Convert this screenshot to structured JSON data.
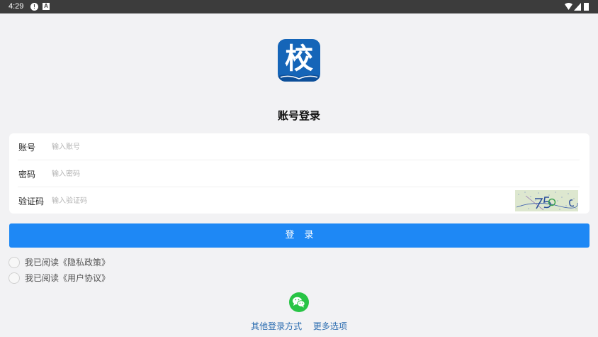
{
  "status_bar": {
    "time": "4:29",
    "alert_glyph": "!",
    "notification_glyph": "A",
    "icons": [
      "alert-icon",
      "a-notification-icon",
      "wifi-icon",
      "signal-icon",
      "battery-icon"
    ]
  },
  "logo": {
    "glyph": "校",
    "color": "#1565b8"
  },
  "title": "账号登录",
  "form": {
    "account": {
      "label": "账号",
      "placeholder": "输入账号",
      "value": ""
    },
    "password": {
      "label": "密码",
      "placeholder": "输入密码",
      "value": ""
    },
    "captcha": {
      "label": "验证码",
      "placeholder": "输入验证码",
      "value": ""
    }
  },
  "login_button": {
    "label": "登录",
    "color": "#1e88f5"
  },
  "agreements": [
    {
      "text": "我已阅读《隐私政策》",
      "checked": false
    },
    {
      "text": "我已阅读《用户协议》",
      "checked": false
    }
  ],
  "wechat": {
    "icon": "wechat-icon",
    "color": "#28c445"
  },
  "bottom_links": {
    "other_login": "其他登录方式",
    "more_options": "更多选项"
  }
}
